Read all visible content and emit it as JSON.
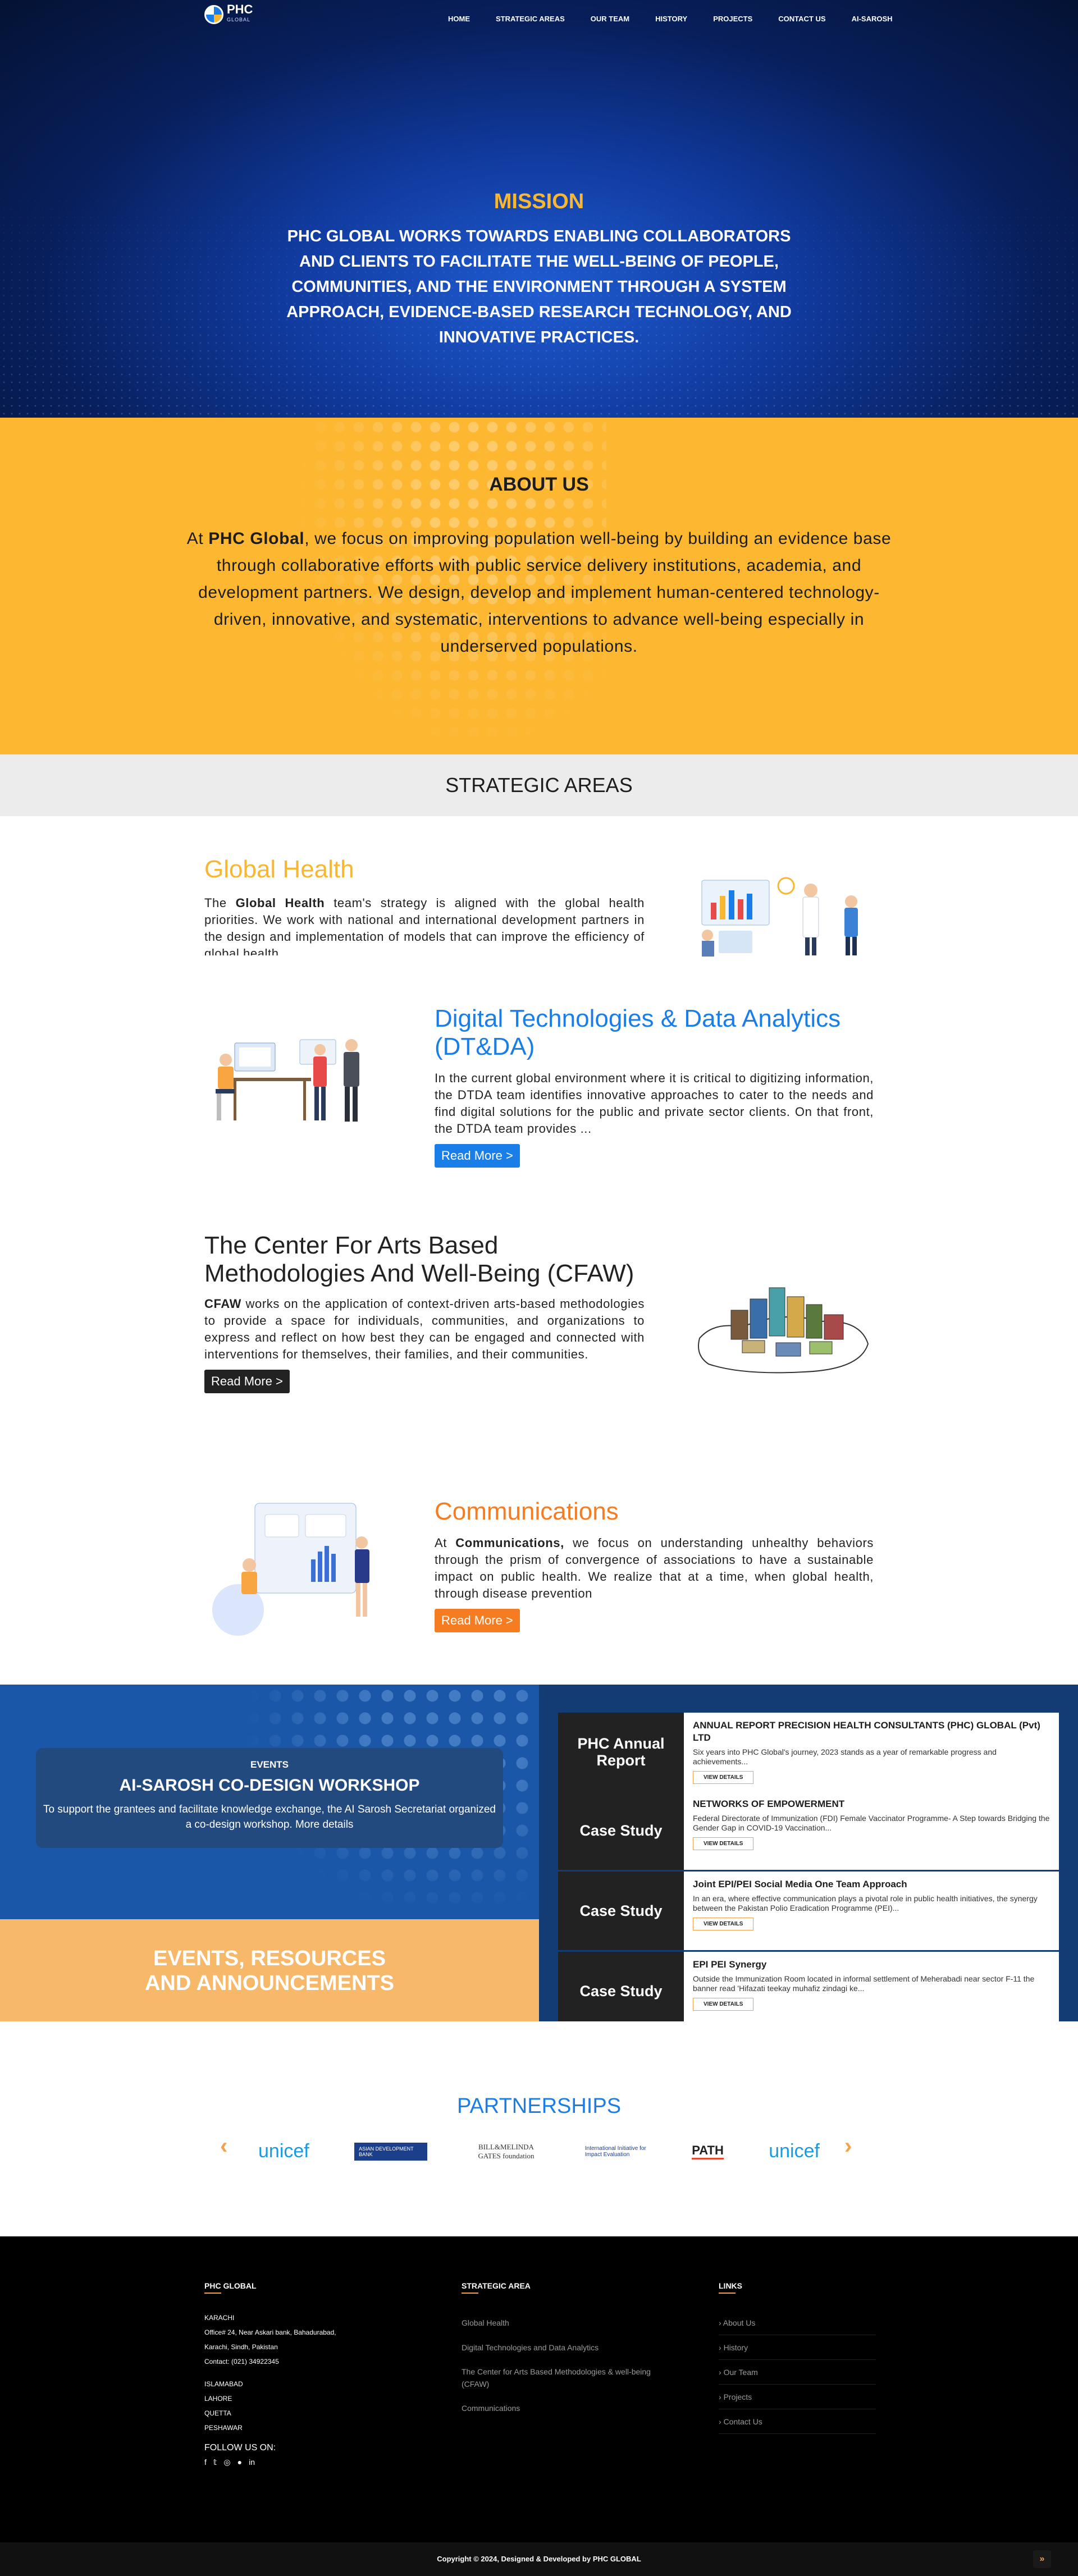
{
  "nav": {
    "logo_text": "PHC",
    "logo_sub": "GLOBAL",
    "items": [
      "HOME",
      "STRATEGIC AREAS",
      "OUR TEAM",
      "HISTORY",
      "PROJECTS",
      "CONTACT US",
      "AI-SAROSH"
    ]
  },
  "hero": {
    "title": "MISSION",
    "text": "PHC GLOBAL WORKS TOWARDS ENABLING COLLABORATORS AND CLIENTS TO FACILITATE THE WELL-BEING OF PEOPLE, COMMUNITIES, AND THE ENVIRONMENT THROUGH A SYSTEM APPROACH, EVIDENCE-BASED RESEARCH TECHNOLOGY, AND INNOVATIVE PRACTICES."
  },
  "about": {
    "title": "ABOUT US",
    "prefix": "At ",
    "brand": "PHC Global",
    "text": ", we focus on improving population well-being by building an evidence base through collaborative efforts with public service delivery institutions, academia, and development partners. We design, develop and implement human-centered technology-driven, innovative, and systematic, interventions to advance well-being especially in underserved populations."
  },
  "strategic": {
    "banner": "STRATEGIC AREAS",
    "items": [
      {
        "title": "Global Health",
        "color": "#f7b733",
        "prefix": "The ",
        "bold": "Global Health",
        "text": " team's strategy is aligned with the global health priorities. We work with national and international development partners in the design and implementation of models that can improve the efficiency of global health"
      },
      {
        "title": "Digital Technologies & Data Analytics (DT&DA)",
        "color": "#1a7ee8",
        "text": "In the current global environment where it is critical to digitizing information, the DTDA team identifies innovative approaches to cater to the needs and find digital solutions for the public and private sector clients. On that front, the DTDA team provides ...",
        "button": "Read More >",
        "button_color": "#1a7ee8"
      },
      {
        "title": "The Center For Arts Based Methodologies And Well-Being (CFAW)",
        "color": "#222222",
        "bold": "CFAW",
        "text": " works on the application of context-driven arts-based methodologies to provide a space for individuals, communities, and organizations to express and reflect on how best they can be engaged and connected with interventions for themselves, their families, and their communities.",
        "button": "Read More >",
        "button_color": "#222222"
      },
      {
        "title": "Communications",
        "color": "#f57c20",
        "prefix": "At ",
        "bold": "Communications,",
        "text": " we focus on understanding unhealthy behaviors through the prism of convergence of associations to have a sustainable impact on public health. We realize that at a time, when global health, through disease prevention",
        "button": "Read More >",
        "button_color": "#f57c20"
      }
    ]
  },
  "events": {
    "tag": "EVENTS",
    "title": "AI-SAROSH CO-DESIGN WORKSHOP",
    "desc": "To support the grantees and facilitate knowledge exchange, the AI Sarosh Secretariat organized a co-design workshop. More details",
    "banner_line1": "EVENTS, RESOURCES",
    "banner_line2": "AND ANNOUNCEMENTS",
    "resources": [
      {
        "type": "PHC Annual Report",
        "title": "ANNUAL REPORT PRECISION HEALTH CONSULTANTS (PHC) GLOBAL (Pvt) LTD",
        "desc": "Six years into PHC Global's journey, 2023 stands as a year of remarkable progress and achievements...",
        "button": "VIEW DETAILS"
      },
      {
        "type": "Case Study",
        "title": "NETWORKS OF EMPOWERMENT",
        "desc": "Federal Directorate of Immunization (FDI) Female Vaccinator Programme- A Step towards Bridging the Gender Gap in COVID-19 Vaccination...",
        "button": "VIEW DETAILS"
      },
      {
        "type": "Case Study",
        "title": "Joint EPI/PEI Social Media One Team Approach",
        "desc": "In an era, where effective communication plays a pivotal role in public health initiatives, the synergy between the Pakistan Polio Eradication Programme (PEI)...",
        "button": "VIEW DETAILS"
      },
      {
        "type": "Case Study",
        "title": "EPI PEI Synergy",
        "desc": "Outside the Immunization Room located in informal settlement of Meherabadi near sector F-11 the banner read 'Hifazati teekay muhafiz zindagi ke...",
        "button": "VIEW DETAILS"
      }
    ]
  },
  "partners": {
    "title": "PARTNERSHIPS",
    "prev": "‹",
    "next": "›",
    "logos": [
      "unicef",
      "ASIAN DEVELOPMENT BANK",
      "BILL&MELINDA GATES foundation",
      "International Initiative for Impact Evaluation",
      "PATH",
      "unicef"
    ]
  },
  "footer": {
    "col1_title": "PHC GLOBAL",
    "city1": "KARACHI",
    "addr1": "Office# 24, Near Askari bank, Bahadurabad,",
    "addr2": "Karachi, Sindh, Pakistan",
    "contact": "Contact: (021) 34922345",
    "cities": [
      "ISLAMABAD",
      "LAHORE",
      "QUETTA",
      "PESHAWAR"
    ],
    "follow": "FOLLOW US ON:",
    "col2_title": "STRATEGIC AREA",
    "col2_links": [
      "Global Health",
      "Digital Technologies and Data Analytics",
      "The Center for Arts Based Methodologies & well-being (CFAW)",
      "Communications"
    ],
    "col3_title": "LINKS",
    "col3_links": [
      "About Us",
      "History",
      "Our Team",
      "Projects",
      "Contact Us"
    ],
    "copyright": "Copyright © 2024, Designed & Developed by PHC GLOBAL"
  }
}
